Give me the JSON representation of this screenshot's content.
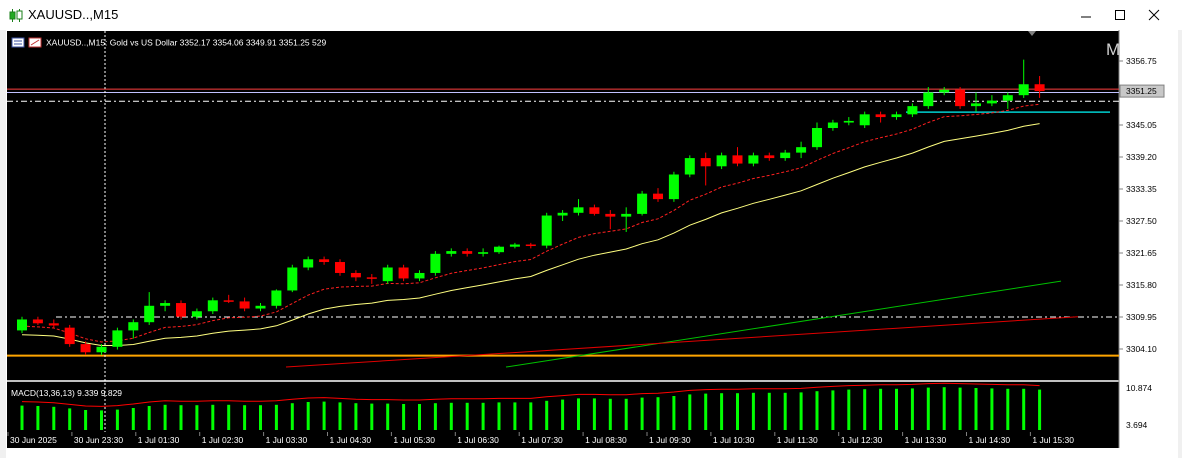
{
  "window": {
    "title": "XAUUSD..,M15",
    "icons": [
      "candlestick-app-icon",
      "minimize-icon",
      "maximize-icon",
      "close-icon"
    ]
  },
  "chart_info": {
    "symbol_line": "XAUUSD..,M15:  Gold vs US Dollar  3352.17 3354.06 3349.91 3351.25  529",
    "m_badge": "M"
  },
  "macd_label": "MACD(13,36,13) 9.339 9.829",
  "colors": {
    "background": "#000000",
    "bull_candle": "#00ff00",
    "bear_candle": "#ff0000",
    "bid_line": "#ff4040",
    "ask_line": "#c0c0ff",
    "ma_fast": "#ff2020",
    "ma_mid": "#ffff80",
    "ma_slow_green": "#00c000",
    "ma_slow_red": "#e00000",
    "support_line": "#ffa500",
    "trend_line": "#00d0d0",
    "macd_hist": "#00ff00",
    "macd_signal": "#ff0000"
  },
  "chart_data": {
    "type": "candlestick",
    "price_axis": {
      "ticks": [
        "3356.75",
        "3351.25",
        "3345.05",
        "3339.20",
        "3333.35",
        "3327.50",
        "3321.65",
        "3315.80",
        "3309.95",
        "3304.10"
      ],
      "current_price": "3351.25",
      "ylim": [
        3300.0,
        3360.0
      ]
    },
    "macd_axis": {
      "ticks": [
        "10.874",
        "3.694"
      ]
    },
    "time_axis": [
      "30 Jun 2025",
      "30 Jun 23:30",
      "1 Jul 01:30",
      "1 Jul 02:30",
      "1 Jul 03:30",
      "1 Jul 04:30",
      "1 Jul 05:30",
      "1 Jul 06:30",
      "1 Jul 07:30",
      "1 Jul 08:30",
      "1 Jul 09:30",
      "1 Jul 10:30",
      "1 Jul 11:30",
      "1 Jul 12:30",
      "1 Jul 13:30",
      "1 Jul 14:30",
      "1 Jul 15:30"
    ],
    "candles": [
      [
        3307.5,
        3310.0,
        3307.0,
        3309.5
      ],
      [
        3309.5,
        3310.0,
        3308.5,
        3308.8
      ],
      [
        3308.8,
        3309.5,
        3308.0,
        3308.4
      ],
      [
        3308.0,
        3308.5,
        3304.5,
        3305.0
      ],
      [
        3305.0,
        3305.5,
        3303.0,
        3303.5
      ],
      [
        3303.5,
        3305.0,
        3303.0,
        3304.5
      ],
      [
        3304.5,
        3308.0,
        3304.0,
        3307.5
      ],
      [
        3307.5,
        3309.5,
        3306.0,
        3309.0
      ],
      [
        3309.0,
        3314.5,
        3308.5,
        3312.0
      ],
      [
        3312.0,
        3313.0,
        3311.0,
        3312.5
      ],
      [
        3312.5,
        3313.0,
        3309.5,
        3310.0
      ],
      [
        3310.0,
        3311.5,
        3309.5,
        3311.0
      ],
      [
        3311.0,
        3313.5,
        3310.5,
        3313.0
      ],
      [
        3313.0,
        3314.0,
        3312.5,
        3312.8
      ],
      [
        3312.8,
        3313.5,
        3311.0,
        3311.5
      ],
      [
        3311.5,
        3312.5,
        3311.0,
        3312.0
      ],
      [
        3312.0,
        3315.0,
        3311.5,
        3314.8
      ],
      [
        3314.8,
        3319.5,
        3314.5,
        3319.0
      ],
      [
        3319.0,
        3321.0,
        3318.5,
        3320.5
      ],
      [
        3320.5,
        3321.0,
        3319.5,
        3320.0
      ],
      [
        3320.0,
        3320.5,
        3317.5,
        3318.0
      ],
      [
        3318.0,
        3318.5,
        3316.5,
        3317.2
      ],
      [
        3317.2,
        3317.8,
        3316.0,
        3317.0
      ],
      [
        3316.5,
        3319.5,
        3316.0,
        3319.0
      ],
      [
        3319.0,
        3319.5,
        3316.5,
        3317.0
      ],
      [
        3317.0,
        3318.5,
        3316.5,
        3318.0
      ],
      [
        3318.0,
        3322.0,
        3317.5,
        3321.5
      ],
      [
        3321.5,
        3322.5,
        3321.0,
        3322.0
      ],
      [
        3322.0,
        3322.5,
        3321.0,
        3321.5
      ],
      [
        3321.5,
        3322.5,
        3321.0,
        3321.8
      ],
      [
        3321.8,
        3323.0,
        3321.5,
        3322.8
      ],
      [
        3322.8,
        3323.5,
        3322.5,
        3323.2
      ],
      [
        3323.2,
        3323.5,
        3322.5,
        3323.0
      ],
      [
        3323.0,
        3329.0,
        3322.5,
        3328.5
      ],
      [
        3328.5,
        3329.5,
        3327.5,
        3329.0
      ],
      [
        3329.0,
        3331.5,
        3328.5,
        3330.0
      ],
      [
        3330.0,
        3330.5,
        3328.5,
        3328.8
      ],
      [
        3328.8,
        3329.5,
        3326.0,
        3328.3
      ],
      [
        3328.3,
        3330.0,
        3325.5,
        3328.8
      ],
      [
        3328.8,
        3333.0,
        3328.5,
        3332.5
      ],
      [
        3332.5,
        3333.5,
        3331.0,
        3331.5
      ],
      [
        3331.5,
        3336.5,
        3331.0,
        3336.0
      ],
      [
        3336.0,
        3339.5,
        3335.5,
        3339.0
      ],
      [
        3339.0,
        3340.0,
        3334.0,
        3337.5
      ],
      [
        3337.5,
        3340.0,
        3337.0,
        3339.5
      ],
      [
        3339.5,
        3341.0,
        3337.5,
        3338.0
      ],
      [
        3338.0,
        3340.0,
        3337.5,
        3339.5
      ],
      [
        3339.5,
        3340.0,
        3338.5,
        3339.0
      ],
      [
        3339.0,
        3340.5,
        3338.5,
        3340.0
      ],
      [
        3340.0,
        3342.0,
        3339.0,
        3341.0
      ],
      [
        3341.0,
        3345.5,
        3340.5,
        3344.5
      ],
      [
        3344.5,
        3346.0,
        3344.0,
        3345.5
      ],
      [
        3345.5,
        3346.5,
        3345.0,
        3345.8
      ],
      [
        3345.0,
        3347.5,
        3344.5,
        3347.0
      ],
      [
        3347.0,
        3347.5,
        3345.5,
        3346.5
      ],
      [
        3346.5,
        3347.5,
        3346.0,
        3347.0
      ],
      [
        3347.0,
        3349.0,
        3346.5,
        3348.5
      ],
      [
        3348.5,
        3352.0,
        3348.0,
        3351.0
      ],
      [
        3351.0,
        3352.0,
        3350.5,
        3351.5
      ],
      [
        3351.5,
        3352.0,
        3348.0,
        3348.5
      ],
      [
        3348.5,
        3351.0,
        3347.5,
        3349.0
      ],
      [
        3349.0,
        3350.5,
        3348.5,
        3349.5
      ],
      [
        3349.5,
        3351.0,
        3348.0,
        3350.5
      ],
      [
        3350.5,
        3357.0,
        3350.0,
        3352.5
      ],
      [
        3352.5,
        3354.0,
        3350.0,
        3351.25
      ]
    ],
    "macd_hist": [
      6.1,
      6.0,
      5.8,
      5.4,
      5.0,
      4.9,
      5.1,
      5.5,
      6.0,
      6.3,
      6.2,
      6.2,
      6.3,
      6.3,
      6.2,
      6.2,
      6.3,
      6.7,
      7.0,
      7.1,
      6.9,
      6.7,
      6.6,
      6.6,
      6.5,
      6.5,
      6.7,
      6.8,
      6.8,
      6.8,
      6.9,
      6.9,
      6.9,
      7.3,
      7.6,
      7.9,
      7.9,
      7.8,
      7.8,
      8.1,
      8.2,
      8.5,
      8.9,
      9.1,
      9.2,
      9.2,
      9.3,
      9.3,
      9.3,
      9.4,
      9.7,
      9.9,
      10.1,
      10.2,
      10.3,
      10.3,
      10.4,
      10.6,
      10.7,
      10.6,
      10.5,
      10.4,
      10.3,
      10.3,
      10.1
    ]
  }
}
